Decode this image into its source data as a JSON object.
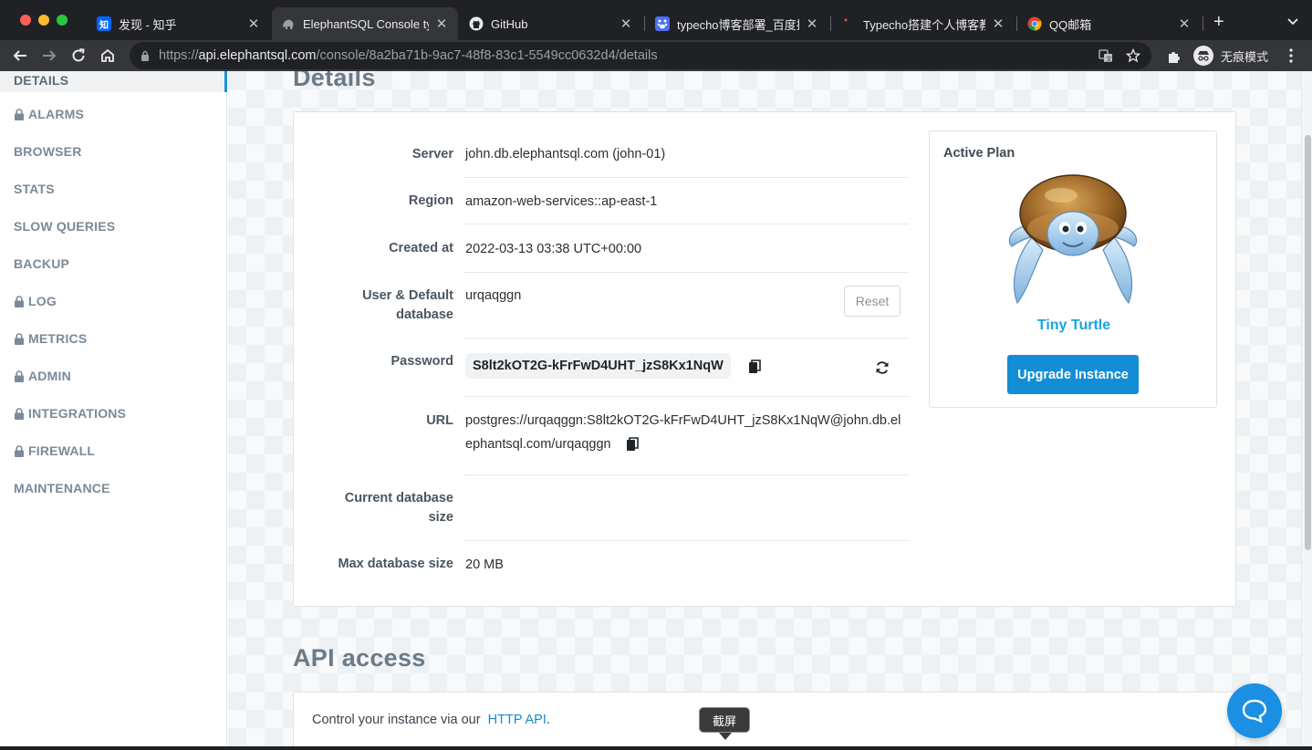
{
  "tabs": [
    {
      "title": "发现 - 知乎",
      "icon": "zhihu-favicon",
      "fav_text": "知",
      "fav_color": "#0066ff"
    },
    {
      "title": "ElephantSQL Console typ",
      "icon": "elephantsql-favicon",
      "fav_color": "#8d8f93"
    },
    {
      "title": "GitHub",
      "icon": "github-favicon"
    },
    {
      "title": "typecho博客部署_百度搜",
      "icon": "baidu-favicon",
      "fav_color": "#4e6ef2"
    },
    {
      "title": "Typecho搭建个人博客教程",
      "icon": "dot-favicon"
    },
    {
      "title": "QQ邮箱",
      "icon": "qqmail-favicon"
    }
  ],
  "address_bar": {
    "scheme": "https://",
    "host": "api.elephantsql.com",
    "path": "/console/8a2ba71b-9ac7-48f8-83c1-5549cc0632d4/details"
  },
  "incognito_label": "无痕模式",
  "sidebar": {
    "items": [
      {
        "label": "DETAILS",
        "locked": false,
        "active": true
      },
      {
        "label": "ALARMS",
        "locked": true
      },
      {
        "label": "BROWSER",
        "locked": false
      },
      {
        "label": "STATS",
        "locked": false
      },
      {
        "label": "SLOW QUERIES",
        "locked": false
      },
      {
        "label": "BACKUP",
        "locked": false
      },
      {
        "label": "LOG",
        "locked": true
      },
      {
        "label": "METRICS",
        "locked": true
      },
      {
        "label": "ADMIN",
        "locked": true
      },
      {
        "label": "INTEGRATIONS",
        "locked": true
      },
      {
        "label": "FIREWALL",
        "locked": true
      },
      {
        "label": "MAINTENANCE",
        "locked": false
      }
    ]
  },
  "details": {
    "heading": "Details",
    "server_label": "Server",
    "server_value": "john.db.elephantsql.com (john-01)",
    "region_label": "Region",
    "region_value": "amazon-web-services::ap-east-1",
    "created_label": "Created at",
    "created_value": "2022-03-13 03:38 UTC+00:00",
    "user_label_1": "User & Default",
    "user_label_2": "database",
    "user_value": "urqaqggn",
    "reset_label": "Reset",
    "password_label": "Password",
    "password_value": "S8lt2kOT2G-kFrFwD4UHT_jzS8Kx1NqW",
    "url_label": "URL",
    "url_value_1": "postgres://urqaqggn:S8lt2kOT2G-kFrFwD4UHT_jzS8Kx1NqW@john.db.el",
    "url_value_2": "ephantsql.com/urqaqggn",
    "current_size_label_1": "Current database",
    "current_size_label_2": "size",
    "current_size_value": "",
    "max_size_label": "Max database size",
    "max_size_value": "20 MB"
  },
  "plan": {
    "title": "Active Plan",
    "name": "Tiny Turtle",
    "upgrade_label": "Upgrade Instance",
    "mascot": "turtle-mascot"
  },
  "api": {
    "heading": "API access",
    "text": "Control your instance via our",
    "link": "HTTP API",
    "suffix": "."
  },
  "tooltip": "截屏",
  "colors": {
    "accent": "#138ed6",
    "plan_name": "#1aa3e0",
    "chat": "#1a8fe3"
  }
}
